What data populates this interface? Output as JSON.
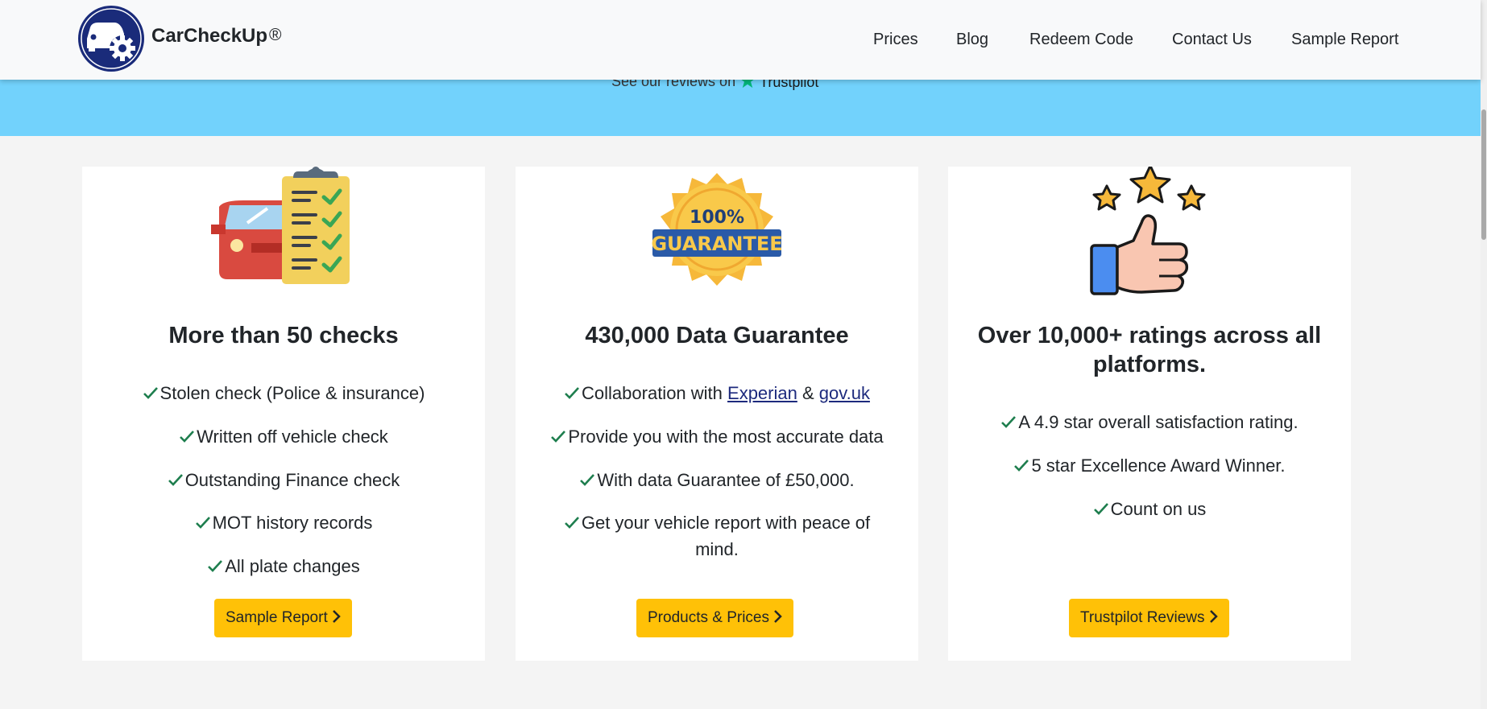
{
  "header": {
    "brand": "CarCheckUp",
    "brand_mark": "®",
    "nav": [
      "Prices",
      "Blog",
      "Redeem Code",
      "Contact Us",
      "Sample Report"
    ]
  },
  "trustpilot": {
    "text": "See our reviews on",
    "brand": "Trustpilot",
    "star_color": "#00b67a"
  },
  "cards": [
    {
      "icon": "car-checklist-icon",
      "title": "More than 50 checks",
      "features": [
        "Stolen check (Police & insurance)",
        "Written off vehicle check",
        "Outstanding Finance check",
        "MOT history records",
        "All plate changes"
      ],
      "button": "Sample Report"
    },
    {
      "icon": "guarantee-badge-icon",
      "badge_top": "100%",
      "badge_bottom": "GUARANTEE",
      "title": "430,000 Data Guarantee",
      "features": {
        "f1_prefix": "Collaboration with ",
        "f1_link1": "Experian",
        "f1_mid": " & ",
        "f1_link2": "gov.uk",
        "f2": "Provide you with the most accurate data",
        "f3": "With data Guarantee of £50,000.",
        "f4_line1": "Get your vehicle report with peace of",
        "f4_line2": "mind."
      },
      "button": "Products & Prices"
    },
    {
      "icon": "thumbs-up-stars-icon",
      "title_line1": "Over 10,000+ ratings across all",
      "title_line2": "platforms.",
      "features": [
        "A 4.9 star overall satisfaction rating.",
        "5 star Excellence Award Winner.",
        "Count on us"
      ],
      "button": "Trustpilot Reviews"
    }
  ],
  "colors": {
    "accent_yellow": "#ffc107",
    "band_blue": "#72d2fc",
    "check_green": "#1e7e4e",
    "link_navy": "#1d2a7d",
    "logo_navy": "#1a2b7a"
  }
}
